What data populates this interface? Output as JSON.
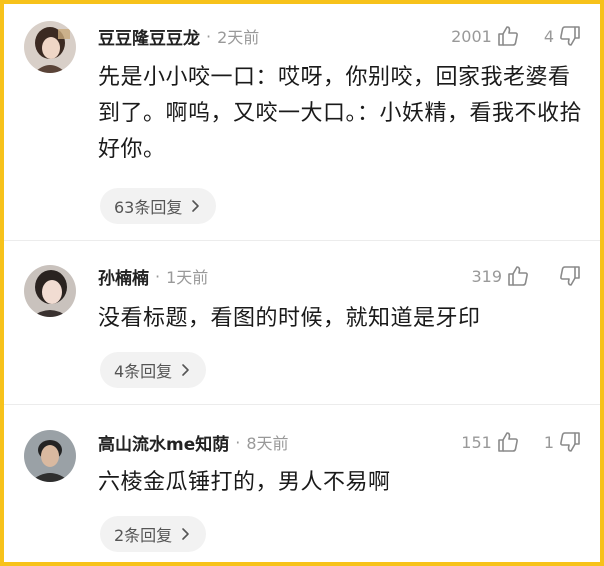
{
  "comments": [
    {
      "name": "豆豆隆豆豆龙",
      "dot": "·",
      "time": "2天前",
      "likes": "2001",
      "dislikes": "4",
      "text": "先是小小咬一口：哎呀，你别咬，回家我老婆看到了。啊呜，又咬一大口。：小妖精，看我不收拾好你。",
      "reply_label": "63条回复",
      "avatar_colors": {
        "bg": "#d8cfc8",
        "hair": "#3b2a22",
        "skin": "#efd6c6"
      }
    },
    {
      "name": "孙楠楠",
      "dot": "·",
      "time": "1天前",
      "likes": "319",
      "dislikes": "",
      "text": "没看标题，看图的时候，就知道是牙印",
      "reply_label": "4条回复",
      "avatar_colors": {
        "bg": "#c9c2bd",
        "hair": "#2a2320",
        "skin": "#f1dcd2"
      }
    },
    {
      "name": "高山流水me知荫",
      "dot": "·",
      "time": "8天前",
      "likes": "151",
      "dislikes": "1",
      "text": "六棱金瓜锤打的，男人不易啊",
      "reply_label": "2条回复",
      "avatar_colors": {
        "bg": "#9aa1a6",
        "hair": "#232323",
        "skin": "#d9b9a0"
      }
    }
  ],
  "icons": {
    "like": "thumbs-up-icon",
    "dislike": "thumbs-down-icon",
    "chevron": "chevron-right-icon"
  },
  "colors": {
    "frame": "#f7c21a",
    "reply_bg": "#f2f2f2",
    "meta_text": "#999999"
  }
}
